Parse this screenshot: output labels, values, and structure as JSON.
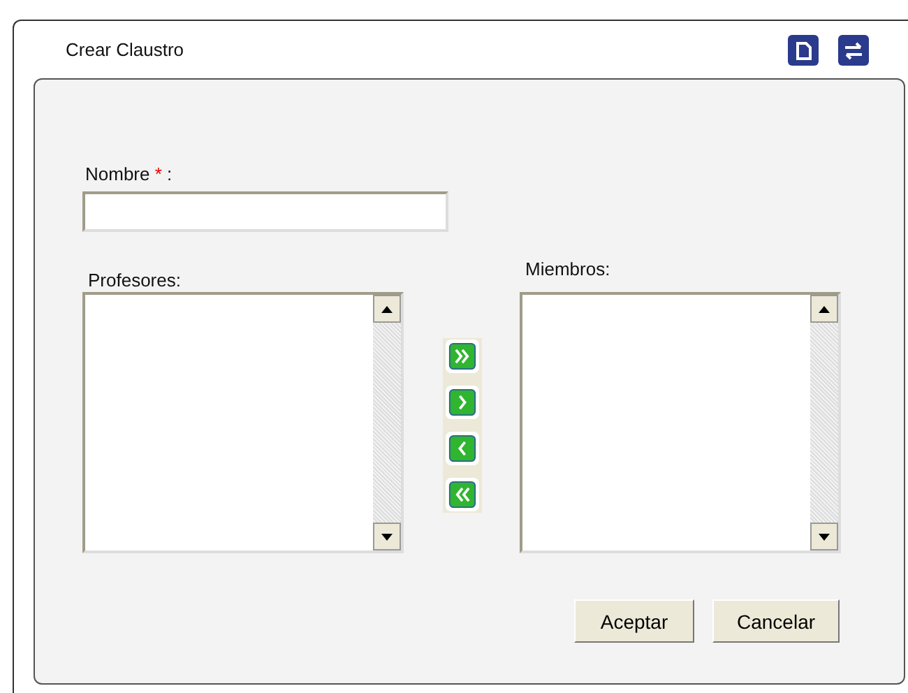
{
  "window": {
    "title": "Crear Claustro"
  },
  "name_field": {
    "label": "Nombre",
    "required_mark": "*",
    "suffix": ":"
  },
  "lists": [
    {
      "label": "Profesores:"
    },
    {
      "label": "Miembros:"
    }
  ],
  "transfer_buttons": [
    {
      "kind": "all-right"
    },
    {
      "kind": "right"
    },
    {
      "kind": "left"
    },
    {
      "kind": "all-left"
    }
  ],
  "buttons": [
    "Aceptar",
    "Cancelar"
  ]
}
